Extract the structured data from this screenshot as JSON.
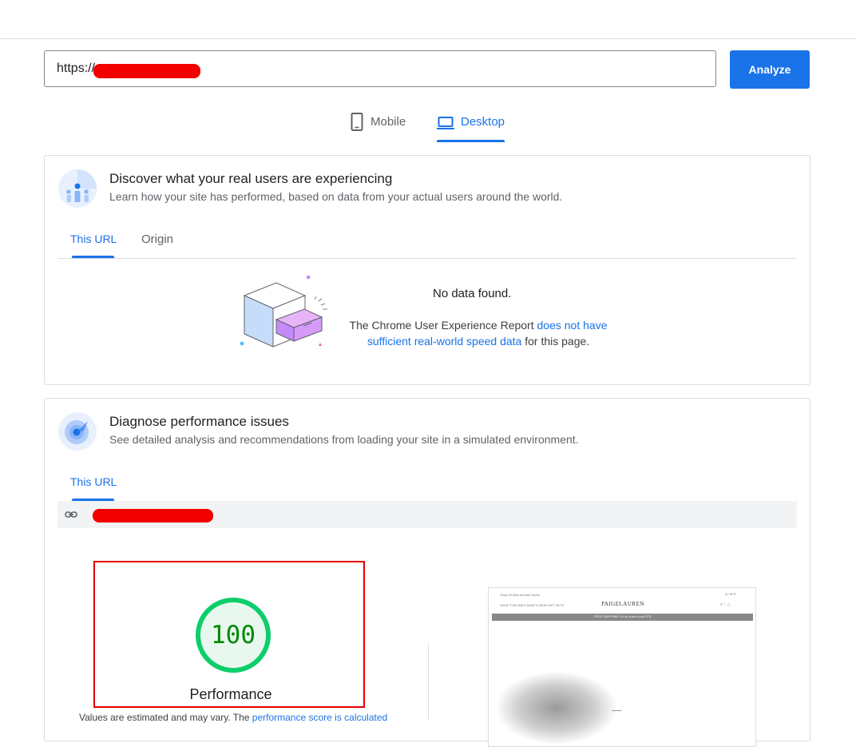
{
  "url_bar": {
    "value": "https://",
    "analyze_label": "Analyze"
  },
  "device_tabs": [
    {
      "label": "Mobile",
      "icon": "phone-icon",
      "active": false
    },
    {
      "label": "Desktop",
      "icon": "laptop-icon",
      "active": true
    }
  ],
  "field_data": {
    "title": "Discover what your real users are experiencing",
    "subtitle": "Learn how your site has performed, based on data from your actual users around the world.",
    "tabs": [
      "This URL",
      "Origin"
    ],
    "no_data_title": "No data found.",
    "no_data_pre": "The Chrome User Experience Report ",
    "no_data_link": "does not have sufficient real-world speed data",
    "no_data_post": " for this page."
  },
  "lab_data": {
    "title": "Diagnose performance issues",
    "subtitle": "See detailed analysis and recommendations from loading your site in a simulated environment.",
    "tab": "This URL",
    "score": "100",
    "score_label": "Performance",
    "disclaimer_pre": "Values are estimated and may vary. The ",
    "disclaimer_link": "performance score is calculated"
  },
  "screenshot_thumb": {
    "brand": "PAIGELAUREN",
    "top_links": "Shop All   New Arrivals   Socks",
    "nav": "SHOP   TOPLINES   WHAT'S NEW   GIFT SETS",
    "banner": "FREE SHIPPING On all orders over $75",
    "social": "◎ f ♥ ℗"
  },
  "colors": {
    "accent": "#1a73e8",
    "score_green": "#0cce6b",
    "score_text": "#008800",
    "highlight_border": "#e60000"
  }
}
